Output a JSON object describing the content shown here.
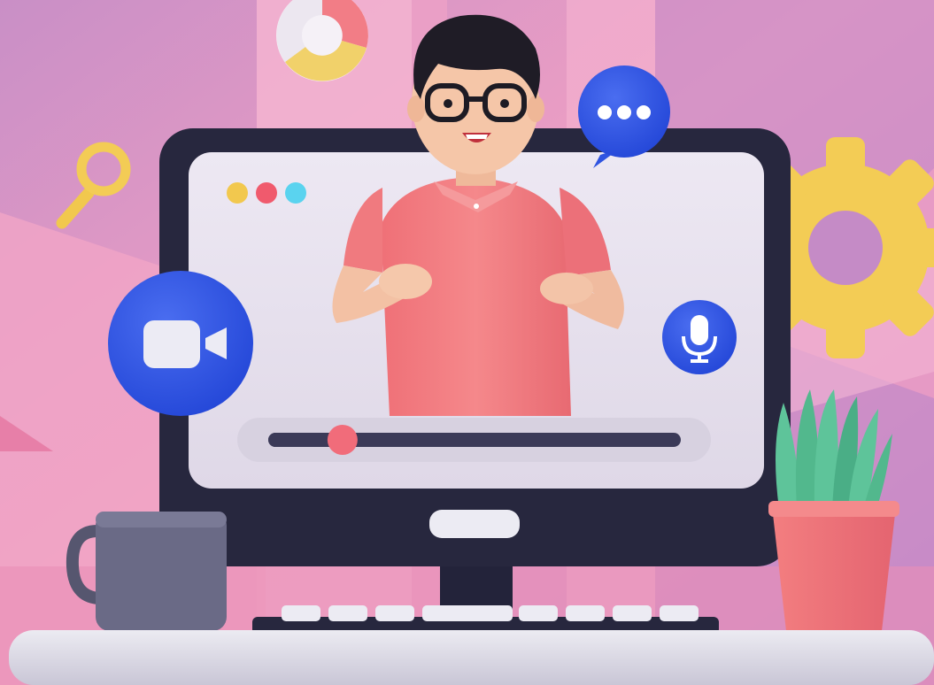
{
  "scene": {
    "title": "",
    "palette": {
      "background_pink": "#f2a9c6",
      "background_purple": "#b985c6",
      "monitor_frame": "#27273e",
      "screen": "#e8e2ef",
      "accent_blue": "#2f54e0",
      "accent_yellow": "#f3cc55",
      "shirt": "#f07a7f",
      "plant_pot": "#f07a7a",
      "leaves": "#5ec49a",
      "mug": "#6a6a86"
    },
    "window_controls": [
      "yellow",
      "red",
      "cyan"
    ],
    "icons": [
      "camera-icon",
      "microphone-icon",
      "chat-bubble-icon",
      "magnifier-icon",
      "gear-icon",
      "donut-chart-icon"
    ],
    "video_progress": 0.18
  }
}
